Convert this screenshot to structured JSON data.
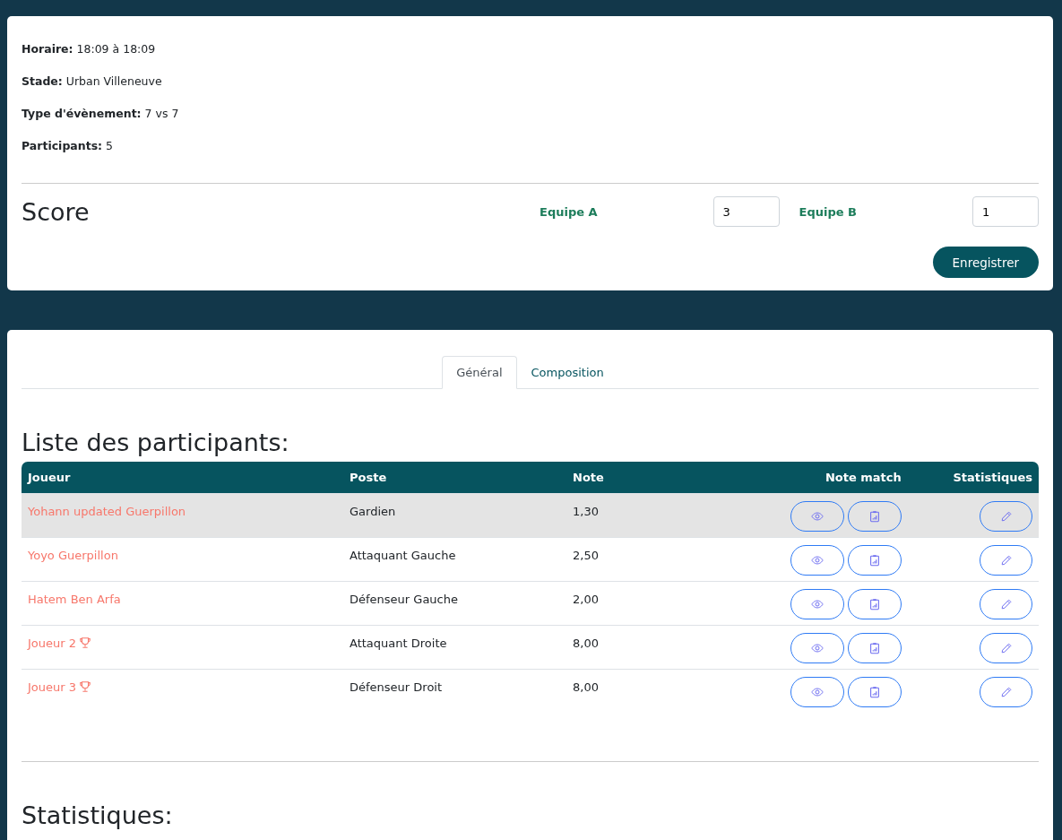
{
  "info": [
    {
      "label": "Horaire:",
      "value": "18:09 à 18:09"
    },
    {
      "label": "Stade:",
      "value": "Urban Villeneuve"
    },
    {
      "label": "Type d'évènement:",
      "value": "7 vs 7"
    },
    {
      "label": "Participants:",
      "value": "5"
    }
  ],
  "score": {
    "title": "Score",
    "teams": [
      {
        "name": "Equipe A",
        "value": "3"
      },
      {
        "name": "Equipe B",
        "value": "1"
      }
    ],
    "save_button": "Enregistrer"
  },
  "tabs": [
    {
      "label": "Général",
      "selected": true
    },
    {
      "label": "Composition",
      "selected": false
    }
  ],
  "participants": {
    "title": "Liste des participants:",
    "columns": [
      "Joueur",
      "Poste",
      "Note",
      "Note match",
      "Statistiques"
    ],
    "rows": [
      {
        "player": "Yohann updated Guerpillon",
        "trophy": false,
        "position": "Gardien",
        "note": "1,30",
        "selected": true
      },
      {
        "player": "Yoyo Guerpillon",
        "trophy": false,
        "position": "Attaquant Gauche",
        "note": "2,50",
        "selected": false
      },
      {
        "player": "Hatem Ben Arfa",
        "trophy": false,
        "position": "Défenseur Gauche",
        "note": "2,00",
        "selected": false
      },
      {
        "player": "Joueur 2",
        "trophy": true,
        "position": "Attaquant Droite",
        "note": "8,00",
        "selected": false
      },
      {
        "player": "Joueur 3",
        "trophy": true,
        "position": "Défenseur Droit",
        "note": "8,00",
        "selected": false
      }
    ]
  },
  "stats_title": "Statistiques:"
}
